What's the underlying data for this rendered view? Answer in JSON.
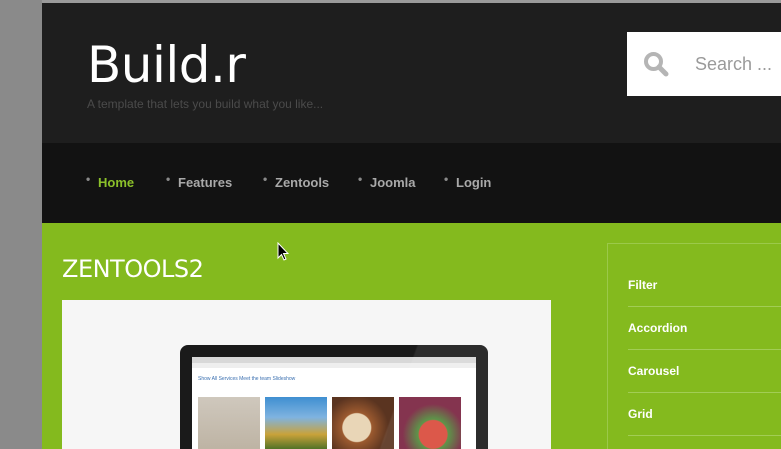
{
  "header": {
    "logo": "Build.r",
    "tagline": "A template that lets you build what you like...",
    "search_placeholder": "Search ..."
  },
  "nav": {
    "items": [
      {
        "label": "Home",
        "active": true
      },
      {
        "label": "Features",
        "active": false
      },
      {
        "label": "Zentools",
        "active": false
      },
      {
        "label": "Joomla",
        "active": false
      },
      {
        "label": "Login",
        "active": false
      }
    ]
  },
  "main": {
    "title": "ZENTOOLS2",
    "image_alt_nav": "Show All    Services    Meet the team    Slideshow"
  },
  "sidebar": {
    "items": [
      {
        "label": "Filter"
      },
      {
        "label": "Accordion"
      },
      {
        "label": "Carousel"
      },
      {
        "label": "Grid"
      }
    ]
  },
  "colors": {
    "accent_green": "#84ba1e",
    "header_bg": "#1e1e1e",
    "nav_bg": "#121212",
    "nav_active": "#8bc02a"
  }
}
